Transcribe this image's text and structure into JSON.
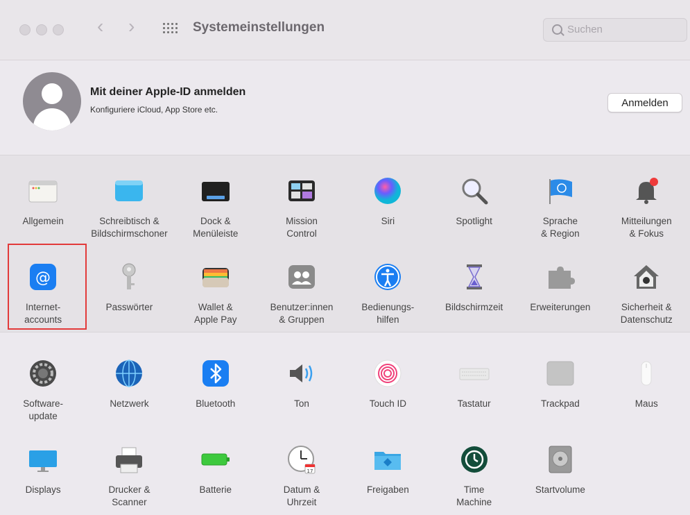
{
  "window": {
    "title": "Systemeinstellungen"
  },
  "search": {
    "placeholder": "Suchen"
  },
  "apple_id": {
    "title": "Mit deiner Apple-ID anmelden",
    "subtitle": "Konfiguriere iCloud, App Store etc.",
    "button": "Anmelden"
  },
  "section1": [
    {
      "label": "Allgemein",
      "icon": "general-icon"
    },
    {
      "label": "Schreibtisch &\nBildschirmschoner",
      "icon": "desktop-icon"
    },
    {
      "label": "Dock &\nMenüleiste",
      "icon": "dock-icon"
    },
    {
      "label": "Mission\nControl",
      "icon": "mission-control-icon"
    },
    {
      "label": "Siri",
      "icon": "siri-icon"
    },
    {
      "label": "Spotlight",
      "icon": "spotlight-icon"
    },
    {
      "label": "Sprache\n& Region",
      "icon": "flag-icon"
    },
    {
      "label": "Mitteilungen\n& Fokus",
      "icon": "bell-icon"
    },
    {
      "label": "Internet-\naccounts",
      "icon": "at-icon"
    },
    {
      "label": "Passwörter",
      "icon": "key-icon"
    },
    {
      "label": "Wallet &\nApple Pay",
      "icon": "wallet-icon"
    },
    {
      "label": "Benutzer:innen\n& Gruppen",
      "icon": "users-icon"
    },
    {
      "label": "Bedienungs-\nhilfen",
      "icon": "accessibility-icon"
    },
    {
      "label": "Bildschirmzeit",
      "icon": "hourglass-icon"
    },
    {
      "label": "Erweiterungen",
      "icon": "puzzle-icon"
    },
    {
      "label": "Sicherheit &\nDatenschutz",
      "icon": "house-lock-icon"
    }
  ],
  "section2": [
    {
      "label": "Software-\nupdate",
      "icon": "gear-icon"
    },
    {
      "label": "Netzwerk",
      "icon": "globe-icon"
    },
    {
      "label": "Bluetooth",
      "icon": "bluetooth-icon"
    },
    {
      "label": "Ton",
      "icon": "speaker-icon"
    },
    {
      "label": "Touch ID",
      "icon": "fingerprint-icon"
    },
    {
      "label": "Tastatur",
      "icon": "keyboard-icon"
    },
    {
      "label": "Trackpad",
      "icon": "trackpad-icon"
    },
    {
      "label": "Maus",
      "icon": "mouse-icon"
    },
    {
      "label": "Displays",
      "icon": "display-icon"
    },
    {
      "label": "Drucker &\nScanner",
      "icon": "printer-icon"
    },
    {
      "label": "Batterie",
      "icon": "battery-icon"
    },
    {
      "label": "Datum &\nUhrzeit",
      "icon": "clock-icon"
    },
    {
      "label": "Freigaben",
      "icon": "folder-icon"
    },
    {
      "label": "Time\nMachine",
      "icon": "time-machine-icon"
    },
    {
      "label": "Startvolume",
      "icon": "disk-icon"
    }
  ],
  "colors": {
    "highlight": "#e23a3a",
    "accent": "#1a7ef2"
  }
}
